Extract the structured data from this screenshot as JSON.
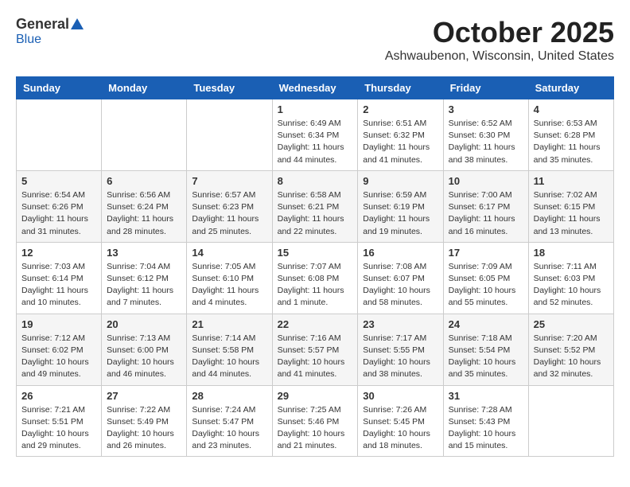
{
  "header": {
    "logo_general": "General",
    "logo_blue": "Blue",
    "month": "October 2025",
    "location": "Ashwaubenon, Wisconsin, United States"
  },
  "weekdays": [
    "Sunday",
    "Monday",
    "Tuesday",
    "Wednesday",
    "Thursday",
    "Friday",
    "Saturday"
  ],
  "weeks": [
    [
      {
        "day": "",
        "info": ""
      },
      {
        "day": "",
        "info": ""
      },
      {
        "day": "",
        "info": ""
      },
      {
        "day": "1",
        "info": "Sunrise: 6:49 AM\nSunset: 6:34 PM\nDaylight: 11 hours\nand 44 minutes."
      },
      {
        "day": "2",
        "info": "Sunrise: 6:51 AM\nSunset: 6:32 PM\nDaylight: 11 hours\nand 41 minutes."
      },
      {
        "day": "3",
        "info": "Sunrise: 6:52 AM\nSunset: 6:30 PM\nDaylight: 11 hours\nand 38 minutes."
      },
      {
        "day": "4",
        "info": "Sunrise: 6:53 AM\nSunset: 6:28 PM\nDaylight: 11 hours\nand 35 minutes."
      }
    ],
    [
      {
        "day": "5",
        "info": "Sunrise: 6:54 AM\nSunset: 6:26 PM\nDaylight: 11 hours\nand 31 minutes."
      },
      {
        "day": "6",
        "info": "Sunrise: 6:56 AM\nSunset: 6:24 PM\nDaylight: 11 hours\nand 28 minutes."
      },
      {
        "day": "7",
        "info": "Sunrise: 6:57 AM\nSunset: 6:23 PM\nDaylight: 11 hours\nand 25 minutes."
      },
      {
        "day": "8",
        "info": "Sunrise: 6:58 AM\nSunset: 6:21 PM\nDaylight: 11 hours\nand 22 minutes."
      },
      {
        "day": "9",
        "info": "Sunrise: 6:59 AM\nSunset: 6:19 PM\nDaylight: 11 hours\nand 19 minutes."
      },
      {
        "day": "10",
        "info": "Sunrise: 7:00 AM\nSunset: 6:17 PM\nDaylight: 11 hours\nand 16 minutes."
      },
      {
        "day": "11",
        "info": "Sunrise: 7:02 AM\nSunset: 6:15 PM\nDaylight: 11 hours\nand 13 minutes."
      }
    ],
    [
      {
        "day": "12",
        "info": "Sunrise: 7:03 AM\nSunset: 6:14 PM\nDaylight: 11 hours\nand 10 minutes."
      },
      {
        "day": "13",
        "info": "Sunrise: 7:04 AM\nSunset: 6:12 PM\nDaylight: 11 hours\nand 7 minutes."
      },
      {
        "day": "14",
        "info": "Sunrise: 7:05 AM\nSunset: 6:10 PM\nDaylight: 11 hours\nand 4 minutes."
      },
      {
        "day": "15",
        "info": "Sunrise: 7:07 AM\nSunset: 6:08 PM\nDaylight: 11 hours\nand 1 minute."
      },
      {
        "day": "16",
        "info": "Sunrise: 7:08 AM\nSunset: 6:07 PM\nDaylight: 10 hours\nand 58 minutes."
      },
      {
        "day": "17",
        "info": "Sunrise: 7:09 AM\nSunset: 6:05 PM\nDaylight: 10 hours\nand 55 minutes."
      },
      {
        "day": "18",
        "info": "Sunrise: 7:11 AM\nSunset: 6:03 PM\nDaylight: 10 hours\nand 52 minutes."
      }
    ],
    [
      {
        "day": "19",
        "info": "Sunrise: 7:12 AM\nSunset: 6:02 PM\nDaylight: 10 hours\nand 49 minutes."
      },
      {
        "day": "20",
        "info": "Sunrise: 7:13 AM\nSunset: 6:00 PM\nDaylight: 10 hours\nand 46 minutes."
      },
      {
        "day": "21",
        "info": "Sunrise: 7:14 AM\nSunset: 5:58 PM\nDaylight: 10 hours\nand 44 minutes."
      },
      {
        "day": "22",
        "info": "Sunrise: 7:16 AM\nSunset: 5:57 PM\nDaylight: 10 hours\nand 41 minutes."
      },
      {
        "day": "23",
        "info": "Sunrise: 7:17 AM\nSunset: 5:55 PM\nDaylight: 10 hours\nand 38 minutes."
      },
      {
        "day": "24",
        "info": "Sunrise: 7:18 AM\nSunset: 5:54 PM\nDaylight: 10 hours\nand 35 minutes."
      },
      {
        "day": "25",
        "info": "Sunrise: 7:20 AM\nSunset: 5:52 PM\nDaylight: 10 hours\nand 32 minutes."
      }
    ],
    [
      {
        "day": "26",
        "info": "Sunrise: 7:21 AM\nSunset: 5:51 PM\nDaylight: 10 hours\nand 29 minutes."
      },
      {
        "day": "27",
        "info": "Sunrise: 7:22 AM\nSunset: 5:49 PM\nDaylight: 10 hours\nand 26 minutes."
      },
      {
        "day": "28",
        "info": "Sunrise: 7:24 AM\nSunset: 5:47 PM\nDaylight: 10 hours\nand 23 minutes."
      },
      {
        "day": "29",
        "info": "Sunrise: 7:25 AM\nSunset: 5:46 PM\nDaylight: 10 hours\nand 21 minutes."
      },
      {
        "day": "30",
        "info": "Sunrise: 7:26 AM\nSunset: 5:45 PM\nDaylight: 10 hours\nand 18 minutes."
      },
      {
        "day": "31",
        "info": "Sunrise: 7:28 AM\nSunset: 5:43 PM\nDaylight: 10 hours\nand 15 minutes."
      },
      {
        "day": "",
        "info": ""
      }
    ]
  ]
}
